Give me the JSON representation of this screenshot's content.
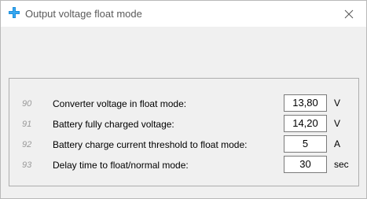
{
  "window": {
    "title": "Output voltage float mode",
    "icon": "plus-blue-icon",
    "close": "close-icon",
    "accent": "#1e8fdc"
  },
  "params": [
    {
      "num": "90",
      "label": "Converter voltage in float mode:",
      "value": "13,80",
      "unit": "V"
    },
    {
      "num": "91",
      "label": "Battery fully charged voltage:",
      "value": "14,20",
      "unit": "V"
    },
    {
      "num": "92",
      "label": "Battery charge current threshold to float mode:",
      "value": "5",
      "unit": "A"
    },
    {
      "num": "93",
      "label": "Delay time to float/normal mode:",
      "value": "30",
      "unit": "sec"
    }
  ]
}
